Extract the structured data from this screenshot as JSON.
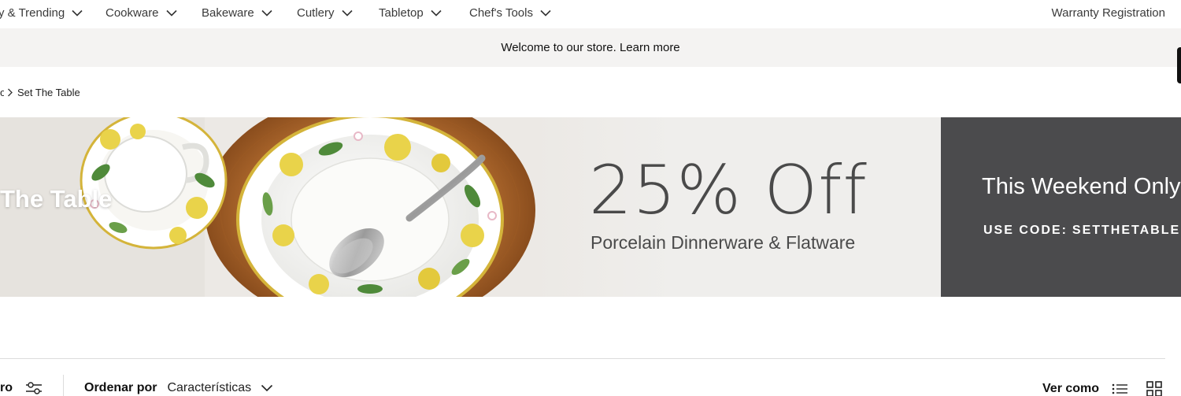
{
  "nav": {
    "items": [
      {
        "label": "y & Trending"
      },
      {
        "label": "Cookware"
      },
      {
        "label": "Bakeware"
      },
      {
        "label": "Cutlery"
      },
      {
        "label": "Tabletop"
      },
      {
        "label": "Chef's Tools"
      }
    ],
    "warranty_label": "Warranty Registration"
  },
  "announcement": {
    "text": "Welcome to our store. Learn more"
  },
  "breadcrumb": {
    "partial": "o",
    "current": "Set The Table"
  },
  "hero": {
    "title": "The Table",
    "offer": "25% Off",
    "subtitle": "Porcelain Dinnerware & Flatware",
    "panel_heading": "This Weekend Only",
    "code_label": "USE CODE:",
    "code_value": "SETTHETABLE"
  },
  "toolbar": {
    "filter_label": "ro",
    "sort_label": "Ordenar por",
    "sort_value": "Características",
    "view_label": "Ver como"
  },
  "colors": {
    "banner_panel": "#4b4b4d",
    "announcement_bg": "#f4f3f2",
    "hero_bg": "#efeeec",
    "wood": "#b06a2e",
    "lemon": "#e9d34a",
    "leaf": "#4f8a3a"
  }
}
